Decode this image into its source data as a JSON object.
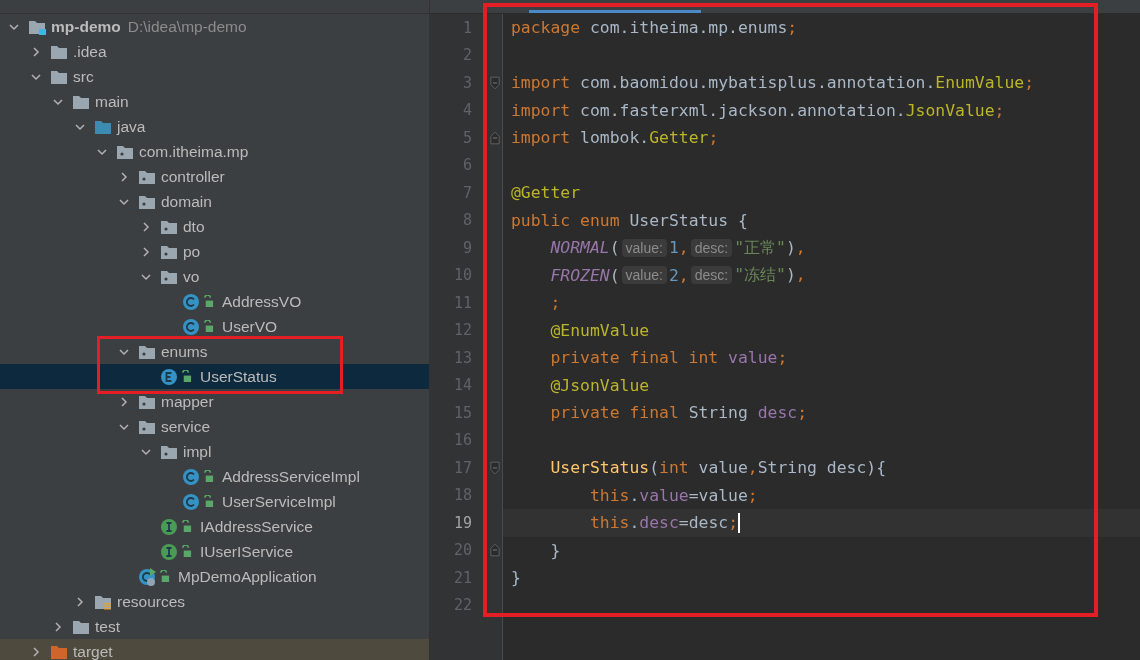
{
  "project_tree": {
    "items": [
      {
        "name": "mp-demo",
        "path": "D:\\idea\\mp-demo",
        "kind": "module",
        "expanded": true,
        "selected": false,
        "children": [
          {
            "name": ".idea",
            "kind": "folder",
            "expanded": false,
            "selected": false
          },
          {
            "name": "src",
            "kind": "folder",
            "expanded": true,
            "selected": false,
            "children": [
              {
                "name": "main",
                "kind": "folder",
                "expanded": true,
                "selected": false,
                "children": [
                  {
                    "name": "java",
                    "kind": "source-folder",
                    "expanded": true,
                    "selected": false,
                    "children": [
                      {
                        "name": "com.itheima.mp",
                        "kind": "package",
                        "expanded": true,
                        "selected": false,
                        "children": [
                          {
                            "name": "controller",
                            "kind": "package",
                            "expanded": false,
                            "selected": false
                          },
                          {
                            "name": "domain",
                            "kind": "package",
                            "expanded": true,
                            "selected": false,
                            "children": [
                              {
                                "name": "dto",
                                "kind": "package",
                                "expanded": false,
                                "selected": false
                              },
                              {
                                "name": "po",
                                "kind": "package",
                                "expanded": false,
                                "selected": false
                              },
                              {
                                "name": "vo",
                                "kind": "package",
                                "expanded": true,
                                "selected": false,
                                "children": [
                                  {
                                    "name": "AddressVO",
                                    "kind": "class",
                                    "selected": false
                                  },
                                  {
                                    "name": "UserVO",
                                    "kind": "class",
                                    "selected": false
                                  }
                                ]
                              }
                            ]
                          },
                          {
                            "name": "enums",
                            "kind": "package",
                            "expanded": true,
                            "selected": false,
                            "children": [
                              {
                                "name": "UserStatus",
                                "kind": "enum",
                                "selected": true
                              }
                            ]
                          },
                          {
                            "name": "mapper",
                            "kind": "package",
                            "expanded": false,
                            "selected": false
                          },
                          {
                            "name": "service",
                            "kind": "package",
                            "expanded": true,
                            "selected": false,
                            "children": [
                              {
                                "name": "impl",
                                "kind": "package",
                                "expanded": true,
                                "selected": false,
                                "children": [
                                  {
                                    "name": "AddressServiceImpl",
                                    "kind": "class",
                                    "selected": false
                                  },
                                  {
                                    "name": "UserServiceImpl",
                                    "kind": "class",
                                    "selected": false
                                  }
                                ]
                              },
                              {
                                "name": "IAddressService",
                                "kind": "interface",
                                "selected": false
                              },
                              {
                                "name": "IUserIService",
                                "kind": "interface",
                                "selected": false
                              }
                            ]
                          },
                          {
                            "name": "MpDemoApplication",
                            "kind": "application",
                            "selected": false
                          }
                        ]
                      }
                    ]
                  },
                  {
                    "name": "resources",
                    "kind": "resources-folder",
                    "expanded": false,
                    "selected": false
                  }
                ]
              },
              {
                "name": "test",
                "kind": "folder",
                "expanded": false,
                "selected": false
              }
            ]
          },
          {
            "name": "target",
            "kind": "excluded-folder",
            "expanded": false,
            "selected": false
          }
        ]
      }
    ]
  },
  "editor": {
    "lines": [
      {
        "number": "1",
        "current": false,
        "tokens": [
          {
            "text": "package ",
            "kind": "keyword"
          },
          {
            "text": "com.itheima.mp.enums",
            "kind": "plain"
          },
          {
            "text": ";",
            "kind": "keyword"
          }
        ]
      },
      {
        "number": "2",
        "current": false
      },
      {
        "number": "3",
        "current": false,
        "fold_start": true,
        "tokens": [
          {
            "text": "import ",
            "kind": "keyword"
          },
          {
            "text": "com.baomidou.mybatisplus.annotation.",
            "kind": "plain"
          },
          {
            "text": "EnumValue",
            "kind": "annotation"
          },
          {
            "text": ";",
            "kind": "keyword"
          }
        ]
      },
      {
        "number": "4",
        "current": false,
        "tokens": [
          {
            "text": "import ",
            "kind": "keyword"
          },
          {
            "text": "com.fasterxml.jackson.annotation.",
            "kind": "plain"
          },
          {
            "text": "JsonValue",
            "kind": "annotation"
          },
          {
            "text": ";",
            "kind": "keyword"
          }
        ]
      },
      {
        "number": "5",
        "current": false,
        "fold_end": true,
        "tokens": [
          {
            "text": "import ",
            "kind": "keyword"
          },
          {
            "text": "lombok.",
            "kind": "plain"
          },
          {
            "text": "Getter",
            "kind": "annotation"
          },
          {
            "text": ";",
            "kind": "keyword"
          }
        ]
      },
      {
        "number": "6",
        "current": false
      },
      {
        "number": "7",
        "current": false,
        "tokens": [
          {
            "text": "@Getter",
            "kind": "annotation"
          }
        ]
      },
      {
        "number": "8",
        "current": false,
        "tokens": [
          {
            "text": "public enum ",
            "kind": "keyword"
          },
          {
            "text": "UserStatus {",
            "kind": "plain"
          }
        ]
      },
      {
        "number": "9",
        "current": false,
        "tokens": [
          {
            "text": "    NORMAL",
            "kind": "constant"
          },
          {
            "text": "(",
            "kind": "plain"
          },
          {
            "text": "value:",
            "kind": "hint"
          },
          {
            "text": "1",
            "kind": "number"
          },
          {
            "text": ",",
            "kind": "keyword"
          },
          {
            "text": "desc:",
            "kind": "hint"
          },
          {
            "text": "\"正常\"",
            "kind": "string"
          },
          {
            "text": ")",
            "kind": "plain"
          },
          {
            "text": ",",
            "kind": "keyword"
          }
        ]
      },
      {
        "number": "10",
        "current": false,
        "tokens": [
          {
            "text": "    FROZEN",
            "kind": "constant"
          },
          {
            "text": "(",
            "kind": "plain"
          },
          {
            "text": "value:",
            "kind": "hint"
          },
          {
            "text": "2",
            "kind": "number"
          },
          {
            "text": ",",
            "kind": "keyword"
          },
          {
            "text": "desc:",
            "kind": "hint"
          },
          {
            "text": "\"冻结\"",
            "kind": "string"
          },
          {
            "text": ")",
            "kind": "plain"
          },
          {
            "text": ",",
            "kind": "keyword"
          }
        ]
      },
      {
        "number": "11",
        "current": false,
        "tokens": [
          {
            "text": "    ;",
            "kind": "keyword"
          }
        ]
      },
      {
        "number": "12",
        "current": false,
        "tokens": [
          {
            "text": "    @EnumValue",
            "kind": "annotation"
          }
        ]
      },
      {
        "number": "13",
        "current": false,
        "tokens": [
          {
            "text": "    private final int ",
            "kind": "keyword"
          },
          {
            "text": "value",
            "kind": "field"
          },
          {
            "text": ";",
            "kind": "keyword"
          }
        ]
      },
      {
        "number": "14",
        "current": false,
        "tokens": [
          {
            "text": "    @JsonValue",
            "kind": "annotation"
          }
        ]
      },
      {
        "number": "15",
        "current": false,
        "tokens": [
          {
            "text": "    private final ",
            "kind": "keyword"
          },
          {
            "text": "String ",
            "kind": "plain"
          },
          {
            "text": "desc",
            "kind": "field"
          },
          {
            "text": ";",
            "kind": "keyword"
          }
        ]
      },
      {
        "number": "16",
        "current": false
      },
      {
        "number": "17",
        "current": false,
        "fold_start": true,
        "tokens": [
          {
            "text": "    UserStatus",
            "kind": "method"
          },
          {
            "text": "(",
            "kind": "plain"
          },
          {
            "text": "int ",
            "kind": "keyword"
          },
          {
            "text": "value",
            "kind": "plain"
          },
          {
            "text": ",",
            "kind": "keyword"
          },
          {
            "text": "String desc){",
            "kind": "plain"
          }
        ]
      },
      {
        "number": "18",
        "current": false,
        "tokens": [
          {
            "text": "        this",
            "kind": "keyword"
          },
          {
            "text": ".",
            "kind": "plain"
          },
          {
            "text": "value",
            "kind": "field"
          },
          {
            "text": "=value",
            "kind": "plain"
          },
          {
            "text": ";",
            "kind": "keyword"
          }
        ]
      },
      {
        "number": "19",
        "current": true,
        "tokens": [
          {
            "text": "        this",
            "kind": "keyword"
          },
          {
            "text": ".",
            "kind": "plain"
          },
          {
            "text": "desc",
            "kind": "field"
          },
          {
            "text": "=desc",
            "kind": "plain"
          },
          {
            "text": ";",
            "kind": "keyword"
          }
        ]
      },
      {
        "number": "20",
        "current": false,
        "fold_end": true,
        "tokens": [
          {
            "text": "    }",
            "kind": "plain"
          }
        ]
      },
      {
        "number": "21",
        "current": false,
        "tokens": [
          {
            "text": "}",
            "kind": "plain"
          }
        ]
      },
      {
        "number": "22",
        "current": false
      }
    ]
  }
}
